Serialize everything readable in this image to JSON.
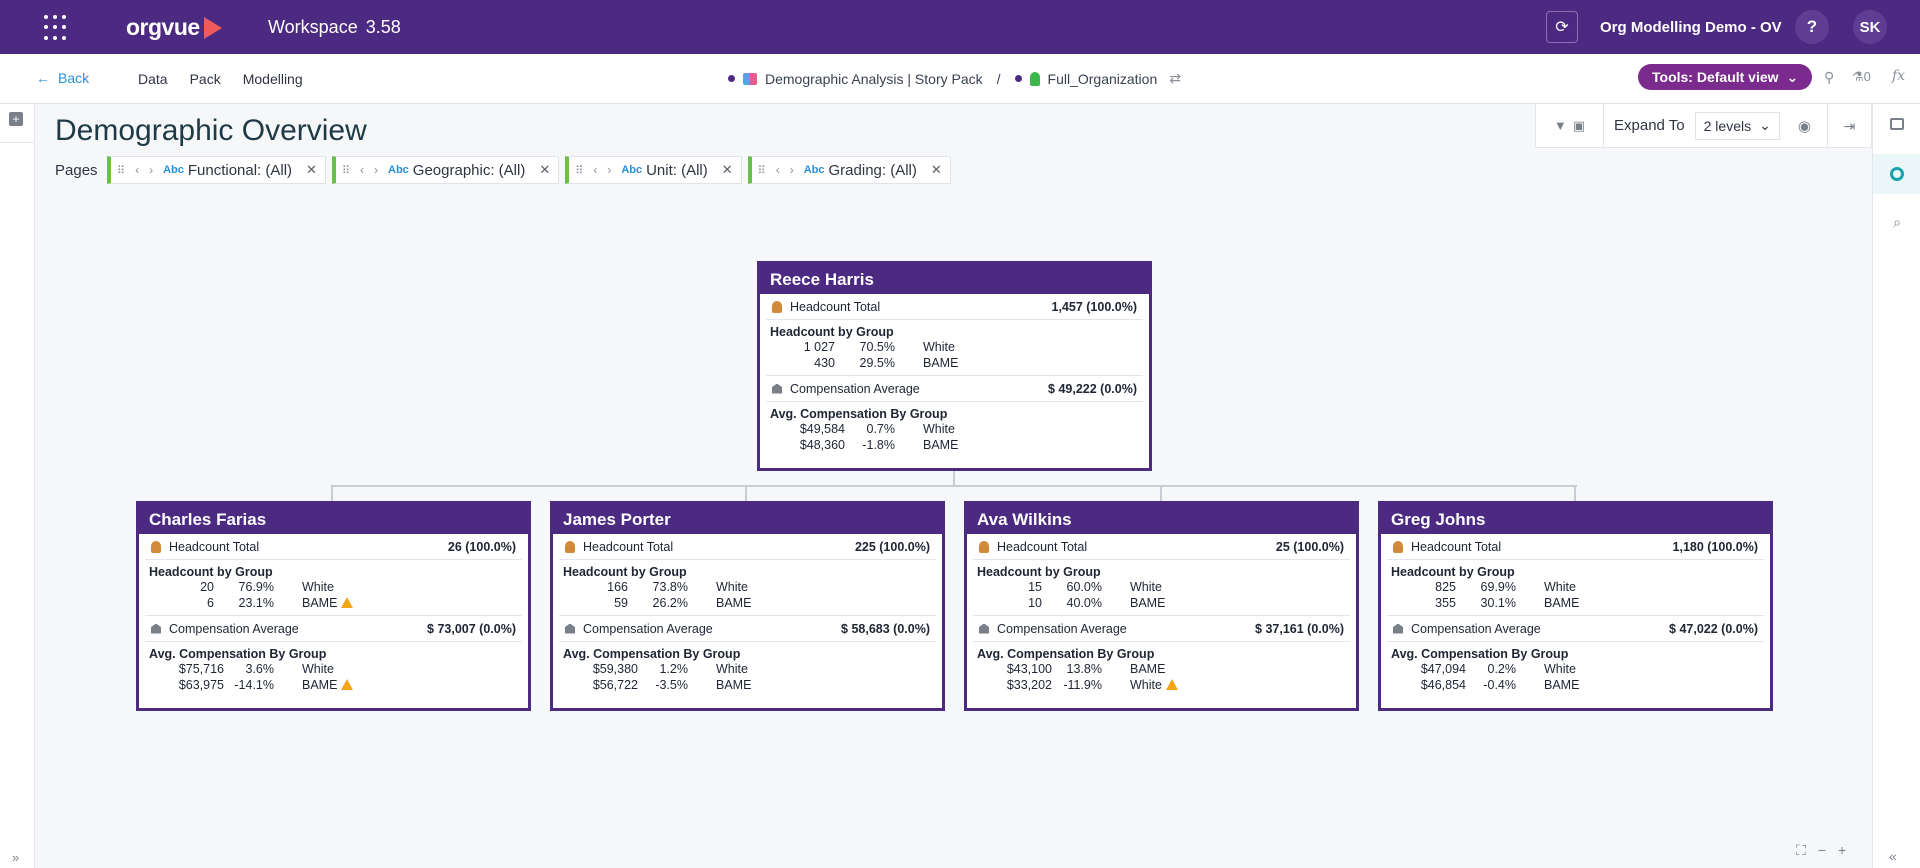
{
  "topbar": {
    "app_name": "orgvue",
    "workspace_label": "Workspace",
    "workspace_version": "3.58",
    "org_name": "Org Modelling Demo - OV",
    "help_label": "?",
    "user_initials": "SK"
  },
  "subnav": {
    "back_label": "Back",
    "menu": [
      "Data",
      "Pack",
      "Modelling"
    ],
    "breadcrumb_pack": "Demographic Analysis | Story Pack",
    "breadcrumb_sep": "/",
    "breadcrumb_dataset": "Full_Organization",
    "tools_label": "Tools: Default view",
    "flask_count": "0",
    "fx_label": "fx"
  },
  "page": {
    "title": "Demographic Overview",
    "pages_label": "Pages",
    "filters": [
      {
        "type": "Abc",
        "label": "Functional: (All)"
      },
      {
        "type": "Abc",
        "label": "Geographic: (All)"
      },
      {
        "type": "Abc",
        "label": "Unit: (All)"
      },
      {
        "type": "Abc",
        "label": "Grading: (All)"
      }
    ],
    "expand_to_label": "Expand To",
    "levels_value": "2 levels"
  },
  "labels": {
    "headcount_total": "Headcount Total",
    "headcount_by_group": "Headcount by Group",
    "compensation_average": "Compensation Average",
    "avg_comp_by_group": "Avg. Compensation By Group"
  },
  "root": {
    "name": "Reece Harris",
    "headcount_total": "1,457 (100.0%)",
    "headcount_groups": [
      {
        "count": "1  027",
        "pct": "70.5%",
        "group": "White"
      },
      {
        "count": "430",
        "pct": "29.5%",
        "group": "BAME"
      }
    ],
    "comp_avg": "$ 49,222 (0.0%)",
    "comp_groups": [
      {
        "amount": "$49,584",
        "pct": "0.7%",
        "group": "White"
      },
      {
        "amount": "$48,360",
        "pct": "-1.8%",
        "group": "BAME"
      }
    ]
  },
  "children": [
    {
      "name": "Charles Farias",
      "headcount_total": "26 (100.0%)",
      "headcount_groups": [
        {
          "count": "20",
          "pct": "76.9%",
          "group": "White",
          "warn": false
        },
        {
          "count": "6",
          "pct": "23.1%",
          "group": "BAME",
          "warn": true
        }
      ],
      "comp_avg": "$ 73,007 (0.0%)",
      "comp_groups": [
        {
          "amount": "$75,716",
          "pct": "3.6%",
          "group": "White",
          "warn": false
        },
        {
          "amount": "$63,975",
          "pct": "-14.1%",
          "group": "BAME",
          "warn": true
        }
      ]
    },
    {
      "name": "James Porter",
      "headcount_total": "225 (100.0%)",
      "headcount_groups": [
        {
          "count": "166",
          "pct": "73.8%",
          "group": "White",
          "warn": false
        },
        {
          "count": "59",
          "pct": "26.2%",
          "group": "BAME",
          "warn": false
        }
      ],
      "comp_avg": "$ 58,683 (0.0%)",
      "comp_groups": [
        {
          "amount": "$59,380",
          "pct": "1.2%",
          "group": "White",
          "warn": false
        },
        {
          "amount": "$56,722",
          "pct": "-3.5%",
          "group": "BAME",
          "warn": false
        }
      ]
    },
    {
      "name": "Ava Wilkins",
      "headcount_total": "25 (100.0%)",
      "headcount_groups": [
        {
          "count": "15",
          "pct": "60.0%",
          "group": "White",
          "warn": false
        },
        {
          "count": "10",
          "pct": "40.0%",
          "group": "BAME",
          "warn": false
        }
      ],
      "comp_avg": "$ 37,161 (0.0%)",
      "comp_groups": [
        {
          "amount": "$43,100",
          "pct": "13.8%",
          "group": "BAME",
          "warn": false
        },
        {
          "amount": "$33,202",
          "pct": "-11.9%",
          "group": "White",
          "warn": true
        }
      ]
    },
    {
      "name": "Greg Johns",
      "headcount_total": "1,180 (100.0%)",
      "headcount_groups": [
        {
          "count": "825",
          "pct": "69.9%",
          "group": "White",
          "warn": false
        },
        {
          "count": "355",
          "pct": "30.1%",
          "group": "BAME",
          "warn": false
        }
      ],
      "comp_avg": "$ 47,022 (0.0%)",
      "comp_groups": [
        {
          "amount": "$47,094",
          "pct": "0.2%",
          "group": "White",
          "warn": false
        },
        {
          "amount": "$46,854",
          "pct": "-0.4%",
          "group": "BAME",
          "warn": false
        }
      ]
    }
  ],
  "icons": {
    "menu": "apps-grid-icon",
    "back": "arrow-left-icon",
    "sync": "refresh-icon",
    "pin": "pin-icon",
    "flask": "flask-icon",
    "filter": "filter-icon",
    "palette": "palette-icon",
    "exit": "exit-icon",
    "warning": "warning-icon"
  },
  "colors": {
    "brand": "#4c2a82",
    "tools_button": "#7b2a8e",
    "filter_accent": "#6bc04b",
    "warning": "#f2a516",
    "link": "#2b8fd6"
  }
}
